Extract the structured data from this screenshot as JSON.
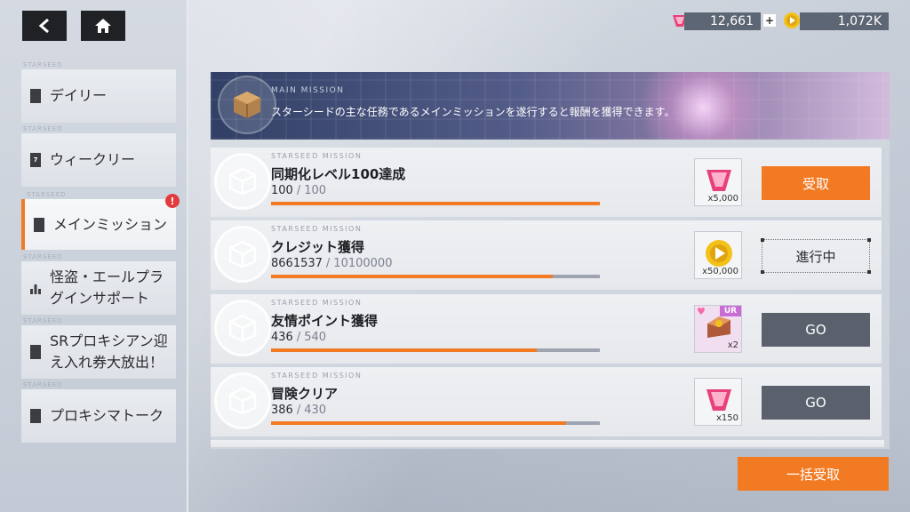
{
  "top_nav": {
    "back_icon": "back-arrow-icon",
    "home_icon": "home-icon"
  },
  "currencies": {
    "gems": {
      "icon": "gem-icon",
      "value": "12,661"
    },
    "coins": {
      "icon": "coin-icon",
      "value": "1,072K"
    }
  },
  "sidebar": {
    "items": [
      {
        "tag": "STARSEED",
        "label": "デイリー"
      },
      {
        "tag": "STARSEED",
        "label": "ウィークリー"
      },
      {
        "tag": "STARSEED",
        "label": "メインミッション",
        "active": true,
        "alert": "!"
      },
      {
        "tag": "STARSEED",
        "label": "怪盗・エールプラグインサポート"
      },
      {
        "tag": "STARSEED",
        "label": "SRプロキシアン迎え入れ券大放出！"
      },
      {
        "tag": "STARSEED",
        "label": "プロキシマトーク"
      }
    ]
  },
  "banner": {
    "tag": "MAIN MISSION",
    "description": "スターシードの主な任務であるメインミッションを遂行すると報酬を獲得できます。"
  },
  "missions": [
    {
      "tag": "STARSEED MISSION",
      "title": "同期化レベル100達成",
      "current": "100",
      "total": "100",
      "progress": 1.0,
      "reward_icon": "gem-icon",
      "reward_qty": "x5,000",
      "button": "受取",
      "button_style": "orange"
    },
    {
      "tag": "STARSEED MISSION",
      "title": "クレジット獲得",
      "current": "8661537",
      "total": "10100000",
      "progress": 0.8576,
      "reward_icon": "coin-icon",
      "reward_qty": "x50,000",
      "button": "進行中",
      "button_style": "progress"
    },
    {
      "tag": "STARSEED MISSION",
      "title": "友情ポイント獲得",
      "current": "436",
      "total": "540",
      "progress": 0.807,
      "reward_icon": "gift-box-icon",
      "reward_qty": "x2",
      "reward_badge": "UR",
      "button": "GO",
      "button_style": "dark"
    },
    {
      "tag": "STARSEED MISSION",
      "title": "冒険クリア",
      "current": "386",
      "total": "430",
      "progress": 0.897,
      "reward_icon": "gem-icon",
      "reward_qty": "x150",
      "button": "GO",
      "button_style": "dark"
    }
  ],
  "claim_all_label": "一括受取",
  "colors": {
    "accent": "#f27a22",
    "dark_button": "#5b616c",
    "alert": "#e33b3b"
  }
}
